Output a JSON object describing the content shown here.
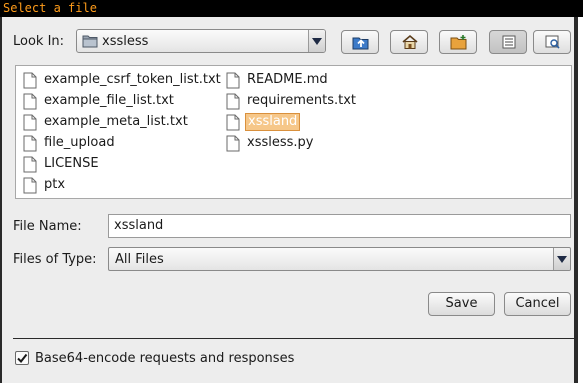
{
  "window": {
    "title": "Select a file"
  },
  "look_in": {
    "label": "Look In:",
    "value": "xssless"
  },
  "toolbar": {
    "buttons": [
      {
        "name": "up-one-level",
        "icon": "folder-up-icon"
      },
      {
        "name": "home",
        "icon": "home-icon"
      },
      {
        "name": "new-folder",
        "icon": "new-folder-icon"
      },
      {
        "name": "list-view",
        "icon": "list-view-icon",
        "active": true
      },
      {
        "name": "details-view",
        "icon": "details-view-icon"
      }
    ]
  },
  "files": {
    "col1": [
      "example_csrf_token_list.txt",
      "example_file_list.txt",
      "example_meta_list.txt",
      "file_upload",
      "LICENSE",
      "ptx"
    ],
    "col2": [
      "README.md",
      "requirements.txt",
      "xssland",
      "xssless.py"
    ],
    "selected": "xssland"
  },
  "file_name": {
    "label": "File Name:",
    "value": "xssland"
  },
  "file_type": {
    "label": "Files of Type:",
    "value": "All Files"
  },
  "buttons": {
    "save": "Save",
    "cancel": "Cancel"
  },
  "option": {
    "label": "Base64-encode requests and responses",
    "checked": true
  },
  "colors": {
    "title_bg": "#000000",
    "title_text": "#ff9c1a",
    "selection_bg": "#f6c789",
    "dialog_bg": "#ededed"
  }
}
